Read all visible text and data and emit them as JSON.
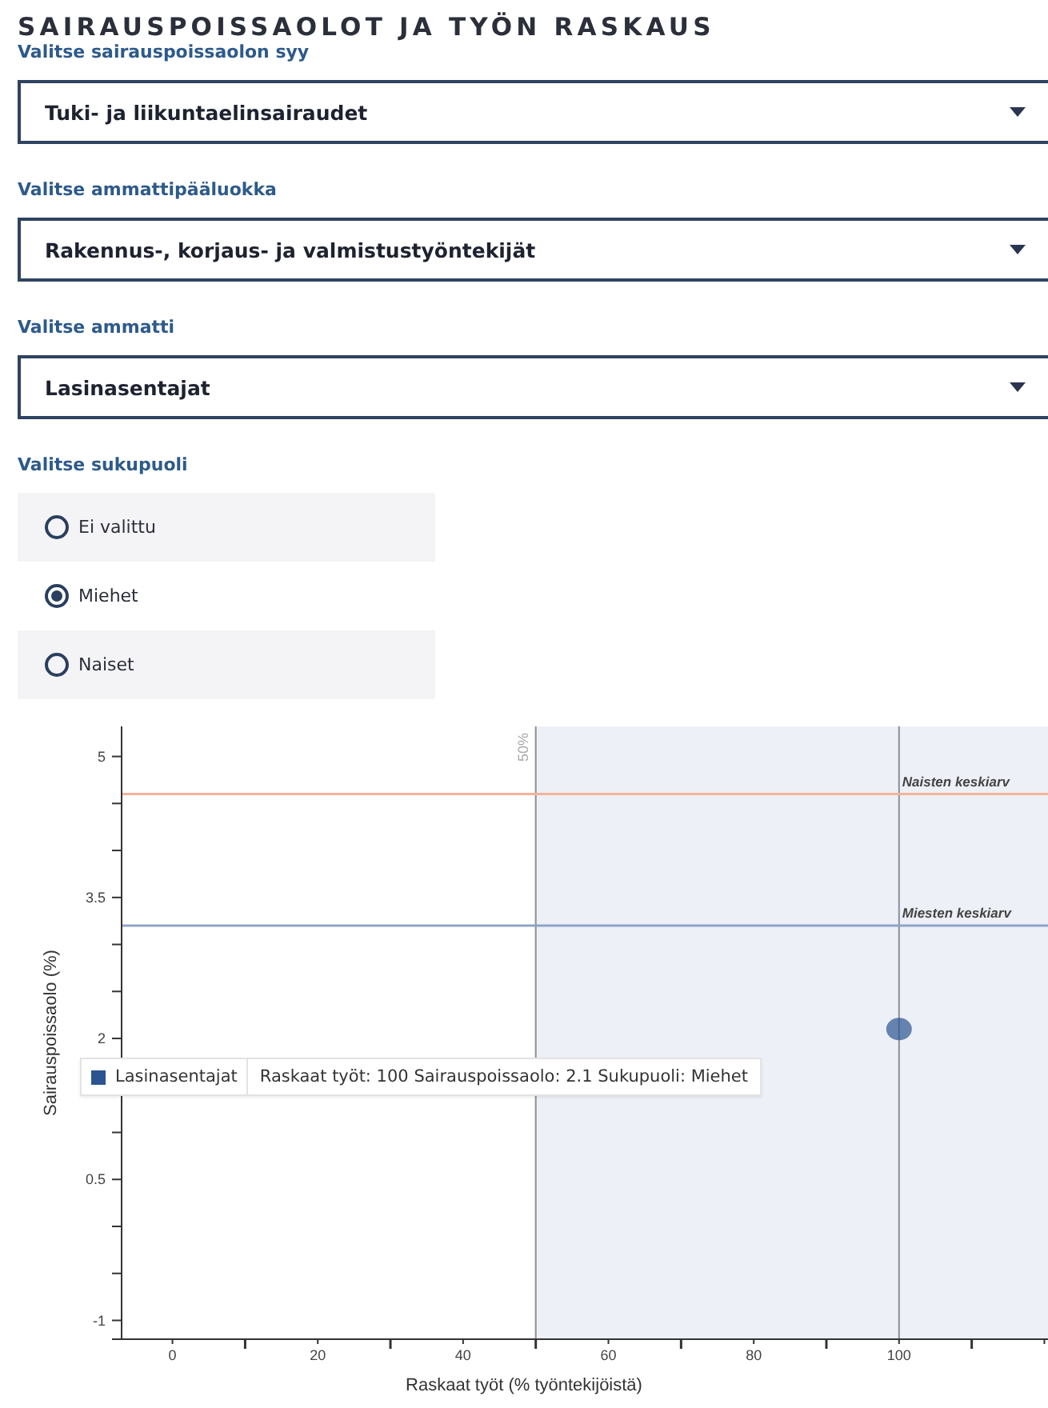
{
  "title": "SAIRAUSPOISSAOLOT JA TYÖN RASKAUS",
  "selects": [
    {
      "label": "Valitse sairauspoissaolon syy",
      "value": "Tuki- ja liikuntaelinsairaudet"
    },
    {
      "label": "Valitse ammattipääluokka",
      "value": "Rakennus-, korjaus- ja valmistustyöntekijät"
    },
    {
      "label": "Valitse ammatti",
      "value": "Lasinasentajat"
    }
  ],
  "gender": {
    "label": "Valitse sukupuoli",
    "options": [
      {
        "label": "Ei valittu",
        "selected": false
      },
      {
        "label": "Miehet",
        "selected": true
      },
      {
        "label": "Naiset",
        "selected": false
      }
    ]
  },
  "chart": {
    "chart_data": {
      "type": "scatter",
      "xlabel": "Raskaat työt (% työntekijöistä)",
      "ylabel": "Sairauspoissaolo (%)",
      "xlim": [
        -7,
        120.5
      ],
      "ylim": [
        -1.2,
        5.32
      ],
      "xticks": [
        0,
        20,
        40,
        60,
        80,
        100
      ],
      "yticks": [
        5,
        3.5,
        2,
        0.5,
        -1
      ],
      "x": [
        100
      ],
      "series": [
        {
          "name": "Lasinasentajat",
          "color": "#2b5491",
          "values": [
            2.1
          ]
        }
      ],
      "ref_lines": [
        {
          "axis": "x",
          "value": 50,
          "label": "50%"
        },
        {
          "axis": "x",
          "value": 100
        },
        {
          "axis": "y",
          "value": 4.6,
          "label": "Naisten keskiarv",
          "color": "#f4b39a"
        },
        {
          "axis": "y",
          "value": 3.2,
          "label": "Miesten keskiarv",
          "color": "#8fa3c4"
        }
      ]
    },
    "tooltip": {
      "text": "Raskaat työt: 100 Sairauspoissaolo: 2.1 Sukupuoli: Miehet"
    }
  }
}
